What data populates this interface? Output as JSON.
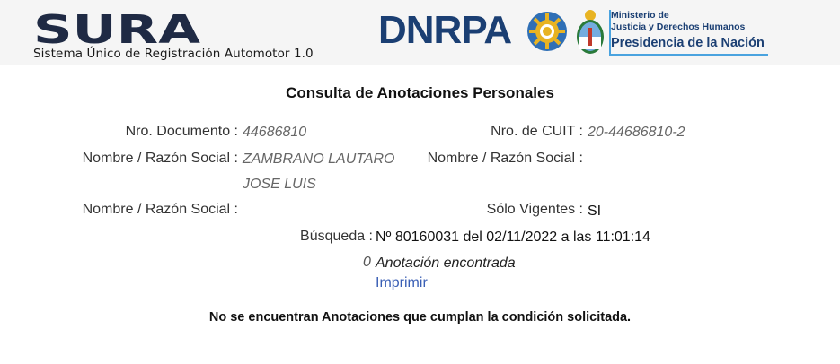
{
  "header": {
    "sura_logo_text": "SURA",
    "sura_subtitle": "Sistema Único de Registración Automotor 1.0",
    "dnrpa_text": "DNRPA",
    "ministerio_line1": "Ministerio de",
    "ministerio_line2": "Justicia y Derechos Humanos",
    "ministerio_line3": "Presidencia de la Nación"
  },
  "page": {
    "title": "Consulta de Anotaciones Personales"
  },
  "fields": {
    "nro_documento_label": "Nro. Documento :",
    "nro_documento_value": "44686810",
    "nro_cuit_label": "Nro. de CUIT :",
    "nro_cuit_value": "20-44686810-2",
    "nombre1_label": "Nombre / Razón Social :",
    "nombre1_value_line1": "ZAMBRANO LAUTARO",
    "nombre1_value_line2": "JOSE LUIS",
    "nombre2_label": "Nombre / Razón Social :",
    "nombre2_value": "",
    "nombre3_label": "Nombre / Razón Social :",
    "nombre3_value": "",
    "solo_vigentes_label": "Sólo Vigentes :",
    "solo_vigentes_value": "SI",
    "busqueda_label": "Búsqueda :",
    "busqueda_value": "Nº 80160031 del 02/11/2022 a las 11:01:14"
  },
  "results": {
    "count": "0",
    "count_label": "Anotación encontrada",
    "print_link": "Imprimir",
    "message": "No se encuentran Anotaciones que cumplan la condición solicitada."
  },
  "colors": {
    "brand_blue": "#1b3f73",
    "sura_dark": "#1f2a44",
    "link_blue": "#3a5fb5",
    "accent_light_blue": "#4aa3df"
  }
}
